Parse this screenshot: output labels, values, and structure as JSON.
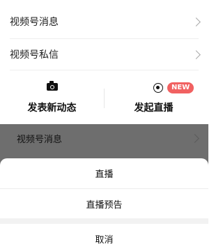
{
  "menu": [
    {
      "label": "视频号消息"
    },
    {
      "label": "视频号私信"
    }
  ],
  "actions": {
    "post": {
      "label": "发表新动态",
      "icon": "camera-icon"
    },
    "live": {
      "label": "发起直播",
      "icon": "live-icon",
      "badge": "NEW"
    }
  },
  "overlay_row": {
    "label": "视频号消息"
  },
  "sheet": {
    "items": [
      {
        "label": "直播"
      },
      {
        "label": "直播预告"
      }
    ],
    "cancel": "取消"
  },
  "colors": {
    "badge": "#f16161",
    "dim_overlay": "rgba(0,0,0,0.57)"
  }
}
